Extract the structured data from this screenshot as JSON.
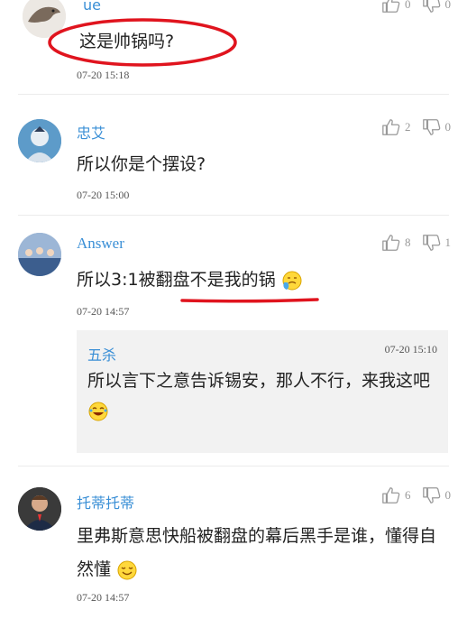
{
  "comments": [
    {
      "username": "ue",
      "content": "这是帅锅吗?",
      "time": "07-20 15:18",
      "likes": "0",
      "dislikes": "0"
    },
    {
      "username": "忠艾",
      "content": "所以你是个摆设?",
      "time": "07-20 15:00",
      "likes": "2",
      "dislikes": "0"
    },
    {
      "username": "Answer",
      "content": "所以3:1被翻盘不是我的锅",
      "time": "07-20 14:57",
      "likes": "8",
      "dislikes": "1",
      "reply": {
        "username": "五杀",
        "time": "07-20 15:10",
        "content": "所以言下之意告诉锡安，那人不行，来我这吧"
      }
    },
    {
      "username": "托蒂托蒂",
      "content": "里弗斯意思快船被翻盘的幕后黑手是谁，懂得自然懂",
      "time": "07-20 14:57",
      "likes": "6",
      "dislikes": "0"
    }
  ],
  "annotation_color": "#e0141e",
  "link_color": "#3a8fd6"
}
